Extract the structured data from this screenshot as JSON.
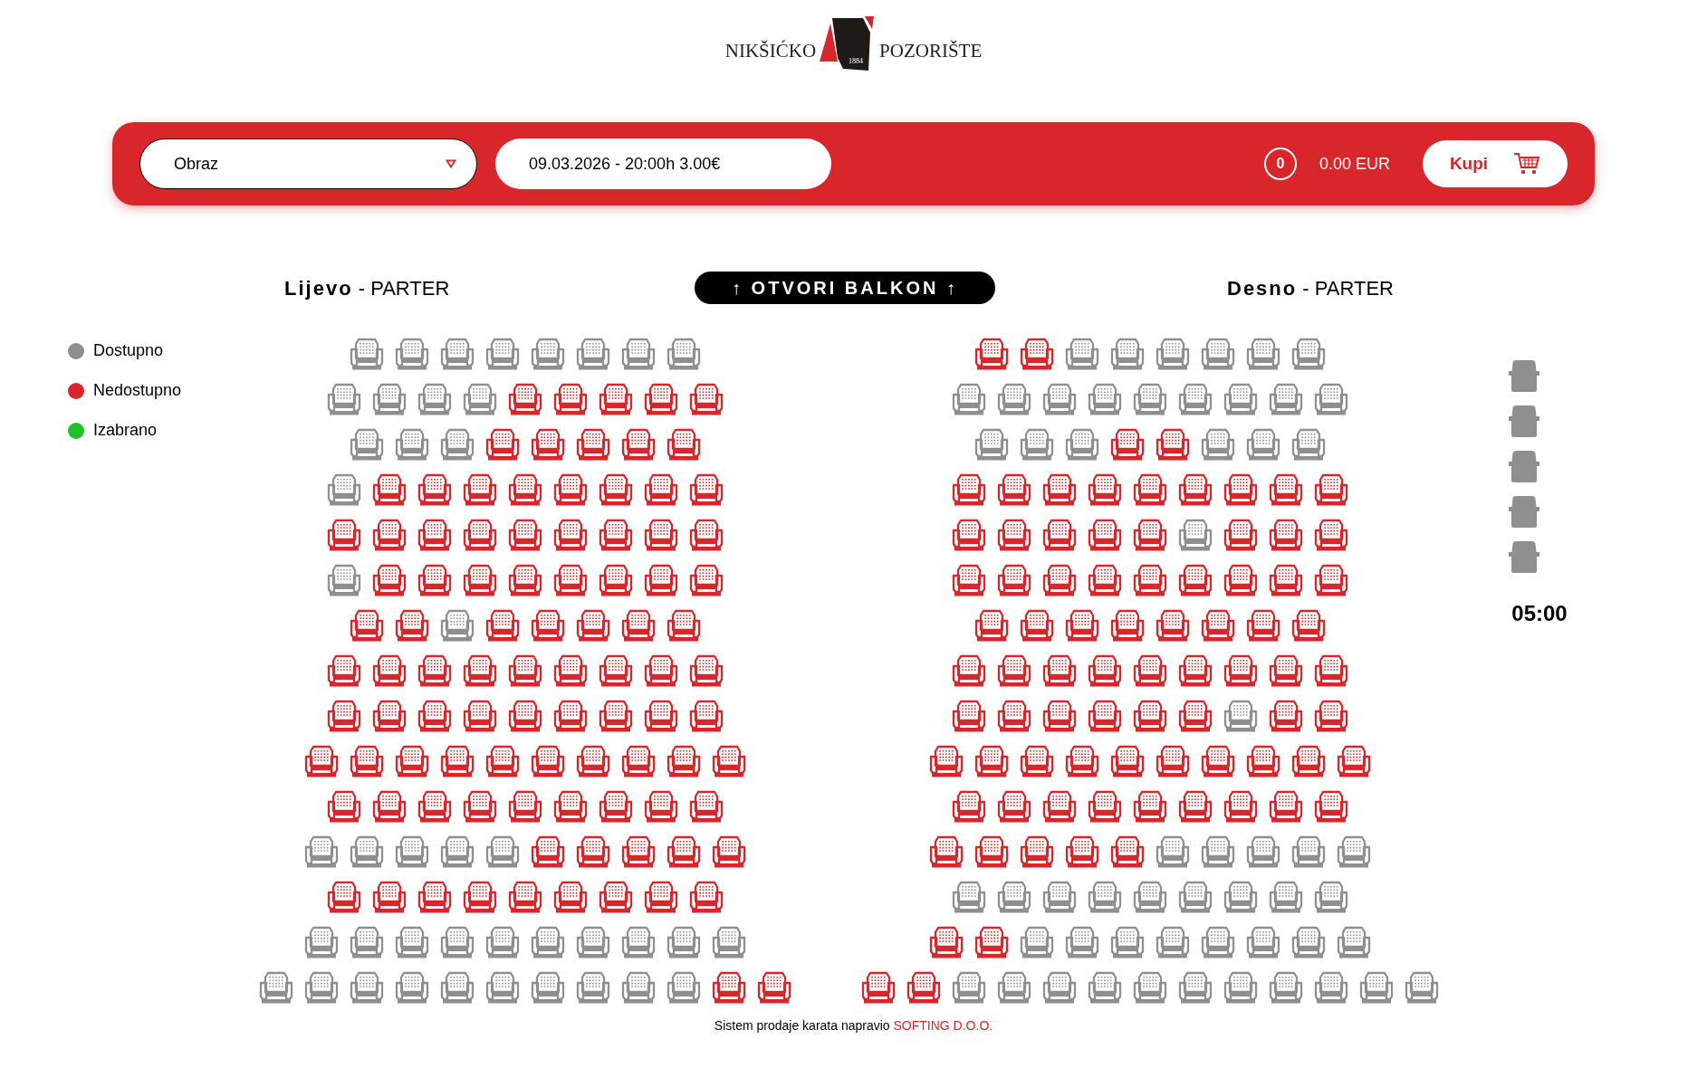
{
  "logo": {
    "left": "NIKŠIĆKO",
    "year": "1884",
    "right": "POZORIŠTE"
  },
  "toolbar": {
    "show_select": {
      "value": "Obraz"
    },
    "date_field": {
      "value": "09.03.2026 - 20:00h 3.00€"
    },
    "ticket_count": "0",
    "total": "0.00 EUR",
    "buy_button": "Kupi"
  },
  "balcony_button": "↑ OTVORI BALKON ↑",
  "legend": [
    {
      "label": "Dostupno",
      "color": "#8f8f8f"
    },
    {
      "label": "Nedostupno",
      "color": "#d9262a"
    },
    {
      "label": "Izabrano",
      "color": "#22c02a"
    }
  ],
  "sections": [
    {
      "heading": "**Lijevo** - PARTER",
      "rows": [
        {
          "seats": [
            {
              "taken": false
            },
            {
              "taken": false
            },
            {
              "taken": false
            },
            {
              "taken": false
            },
            {
              "taken": false
            },
            {
              "taken": false
            },
            {
              "taken": false
            },
            {
              "taken": false
            }
          ]
        },
        {
          "seats": [
            {
              "taken": false
            },
            {
              "taken": false
            },
            {
              "taken": false
            },
            {
              "taken": false
            },
            {
              "taken": true
            },
            {
              "taken": true
            },
            {
              "taken": true
            },
            {
              "taken": true
            },
            {
              "taken": true
            }
          ]
        },
        {
          "seats": [
            {
              "taken": false
            },
            {
              "taken": false
            },
            {
              "taken": false
            },
            {
              "taken": true
            },
            {
              "taken": true
            },
            {
              "taken": true
            },
            {
              "taken": true
            },
            {
              "taken": true
            }
          ]
        },
        {
          "seats": [
            {
              "taken": false
            },
            {
              "taken": true
            },
            {
              "taken": true
            },
            {
              "taken": true
            },
            {
              "taken": true
            },
            {
              "taken": true
            },
            {
              "taken": true
            },
            {
              "taken": true
            },
            {
              "taken": true
            }
          ]
        },
        {
          "seats": [
            {
              "taken": true
            },
            {
              "taken": true
            },
            {
              "taken": true
            },
            {
              "taken": true
            },
            {
              "taken": true
            },
            {
              "taken": true
            },
            {
              "taken": true
            },
            {
              "taken": true
            },
            {
              "taken": true
            }
          ]
        },
        {
          "seats": [
            {
              "taken": false
            },
            {
              "taken": true
            },
            {
              "taken": true
            },
            {
              "taken": true
            },
            {
              "taken": true
            },
            {
              "taken": true
            },
            {
              "taken": true
            },
            {
              "taken": true
            },
            {
              "taken": true
            }
          ]
        },
        {
          "seats": [
            {
              "taken": true
            },
            {
              "taken": true
            },
            {
              "taken": false
            },
            {
              "taken": true
            },
            {
              "taken": true
            },
            {
              "taken": true
            },
            {
              "taken": true
            },
            {
              "taken": true
            }
          ]
        },
        {
          "seats": [
            {
              "taken": true
            },
            {
              "taken": true
            },
            {
              "taken": true
            },
            {
              "taken": true
            },
            {
              "taken": true
            },
            {
              "taken": true
            },
            {
              "taken": true
            },
            {
              "taken": true
            },
            {
              "taken": true
            }
          ]
        },
        {
          "seats": [
            {
              "taken": true
            },
            {
              "taken": true
            },
            {
              "taken": true
            },
            {
              "taken": true
            },
            {
              "taken": true
            },
            {
              "taken": true
            },
            {
              "taken": true
            },
            {
              "taken": true
            },
            {
              "taken": true
            }
          ]
        },
        {
          "seats": [
            {
              "taken": true
            },
            {
              "taken": true
            },
            {
              "taken": true
            },
            {
              "taken": true
            },
            {
              "taken": true
            },
            {
              "taken": true
            },
            {
              "taken": true
            },
            {
              "taken": true
            },
            {
              "taken": true
            },
            {
              "taken": true
            }
          ]
        },
        {
          "seats": [
            {
              "taken": true
            },
            {
              "taken": true
            },
            {
              "taken": true
            },
            {
              "taken": true
            },
            {
              "taken": true
            },
            {
              "taken": true
            },
            {
              "taken": true
            },
            {
              "taken": true
            },
            {
              "taken": true
            }
          ]
        },
        {
          "seats": [
            {
              "taken": false
            },
            {
              "taken": false
            },
            {
              "taken": false
            },
            {
              "taken": false
            },
            {
              "taken": false
            },
            {
              "taken": true
            },
            {
              "taken": true
            },
            {
              "taken": true
            },
            {
              "taken": true
            },
            {
              "taken": true
            }
          ]
        },
        {
          "seats": [
            {
              "taken": true
            },
            {
              "taken": true
            },
            {
              "taken": true
            },
            {
              "taken": true
            },
            {
              "taken": true
            },
            {
              "taken": true
            },
            {
              "taken": true
            },
            {
              "taken": true
            },
            {
              "taken": true
            }
          ]
        },
        {
          "seats": [
            {
              "taken": false
            },
            {
              "taken": false
            },
            {
              "taken": false
            },
            {
              "taken": false
            },
            {
              "taken": false
            },
            {
              "taken": false
            },
            {
              "taken": false
            },
            {
              "taken": false
            },
            {
              "taken": false
            },
            {
              "taken": false
            }
          ]
        },
        {
          "seats": [
            {
              "taken": false
            },
            {
              "taken": false
            },
            {
              "taken": false
            },
            {
              "taken": false
            },
            {
              "taken": false
            },
            {
              "taken": false
            },
            {
              "taken": false
            },
            {
              "taken": false
            },
            {
              "taken": false
            },
            {
              "taken": false
            },
            {
              "taken": true
            },
            {
              "taken": true
            }
          ]
        }
      ]
    },
    {
      "heading": "**Desno** - PARTER",
      "rows": [
        {
          "seats": [
            {
              "taken": true
            },
            {
              "taken": true
            },
            {
              "taken": false
            },
            {
              "taken": false
            },
            {
              "taken": false
            },
            {
              "taken": false
            },
            {
              "taken": false
            },
            {
              "taken": false
            }
          ]
        },
        {
          "seats": [
            {
              "taken": false
            },
            {
              "taken": false
            },
            {
              "taken": false
            },
            {
              "taken": false
            },
            {
              "taken": false
            },
            {
              "taken": false
            },
            {
              "taken": false
            },
            {
              "taken": false
            },
            {
              "taken": false
            }
          ]
        },
        {
          "seats": [
            {
              "taken": false
            },
            {
              "taken": false
            },
            {
              "taken": false
            },
            {
              "taken": true
            },
            {
              "taken": true
            },
            {
              "taken": false
            },
            {
              "taken": false
            },
            {
              "taken": false
            }
          ]
        },
        {
          "seats": [
            {
              "taken": true
            },
            {
              "taken": true
            },
            {
              "taken": true
            },
            {
              "taken": true
            },
            {
              "taken": true
            },
            {
              "taken": true
            },
            {
              "taken": true
            },
            {
              "taken": true
            },
            {
              "taken": true
            }
          ]
        },
        {
          "seats": [
            {
              "taken": true
            },
            {
              "taken": true
            },
            {
              "taken": true
            },
            {
              "taken": true
            },
            {
              "taken": true
            },
            {
              "taken": false
            },
            {
              "taken": true
            },
            {
              "taken": true
            },
            {
              "taken": true
            }
          ]
        },
        {
          "seats": [
            {
              "taken": true
            },
            {
              "taken": true
            },
            {
              "taken": true
            },
            {
              "taken": true
            },
            {
              "taken": true
            },
            {
              "taken": true
            },
            {
              "taken": true
            },
            {
              "taken": true
            },
            {
              "taken": true
            }
          ]
        },
        {
          "seats": [
            {
              "taken": true
            },
            {
              "taken": true
            },
            {
              "taken": true
            },
            {
              "taken": true
            },
            {
              "taken": true
            },
            {
              "taken": true
            },
            {
              "taken": true
            },
            {
              "taken": true
            }
          ]
        },
        {
          "seats": [
            {
              "taken": true
            },
            {
              "taken": true
            },
            {
              "taken": true
            },
            {
              "taken": true
            },
            {
              "taken": true
            },
            {
              "taken": true
            },
            {
              "taken": true
            },
            {
              "taken": true
            },
            {
              "taken": true
            }
          ]
        },
        {
          "seats": [
            {
              "taken": true
            },
            {
              "taken": true
            },
            {
              "taken": true
            },
            {
              "taken": true
            },
            {
              "taken": true
            },
            {
              "taken": true
            },
            {
              "taken": false
            },
            {
              "taken": true
            },
            {
              "taken": true
            }
          ]
        },
        {
          "seats": [
            {
              "taken": true
            },
            {
              "taken": true
            },
            {
              "taken": true
            },
            {
              "taken": true
            },
            {
              "taken": true
            },
            {
              "taken": true
            },
            {
              "taken": true
            },
            {
              "taken": true
            },
            {
              "taken": true
            },
            {
              "taken": true
            }
          ]
        },
        {
          "seats": [
            {
              "taken": true
            },
            {
              "taken": true
            },
            {
              "taken": true
            },
            {
              "taken": true
            },
            {
              "taken": true
            },
            {
              "taken": true
            },
            {
              "taken": true
            },
            {
              "taken": true
            },
            {
              "taken": true
            }
          ]
        },
        {
          "seats": [
            {
              "taken": true
            },
            {
              "taken": true
            },
            {
              "taken": true
            },
            {
              "taken": true
            },
            {
              "taken": true
            },
            {
              "taken": false
            },
            {
              "taken": false
            },
            {
              "taken": false
            },
            {
              "taken": false
            },
            {
              "taken": false
            }
          ]
        },
        {
          "seats": [
            {
              "taken": false
            },
            {
              "taken": false
            },
            {
              "taken": false
            },
            {
              "taken": false
            },
            {
              "taken": false
            },
            {
              "taken": false
            },
            {
              "taken": false
            },
            {
              "taken": false
            },
            {
              "taken": false
            }
          ]
        },
        {
          "seats": [
            {
              "taken": true
            },
            {
              "taken": true
            },
            {
              "taken": false
            },
            {
              "taken": false
            },
            {
              "taken": false
            },
            {
              "taken": false
            },
            {
              "taken": false
            },
            {
              "taken": false
            },
            {
              "taken": false
            },
            {
              "taken": false
            }
          ]
        },
        {
          "seats": [
            {
              "taken": true
            },
            {
              "taken": true
            },
            {
              "taken": false
            },
            {
              "taken": false
            },
            {
              "taken": false
            },
            {
              "taken": false
            },
            {
              "taken": false
            },
            {
              "taken": false
            },
            {
              "taken": false
            },
            {
              "taken": false
            },
            {
              "taken": false
            },
            {
              "taken": false
            },
            {
              "taken": false
            }
          ]
        }
      ]
    }
  ],
  "timer": "05:00",
  "footer": {
    "text": "Sistem prodaje karata napravio",
    "link": "SOFTING D.O.O."
  }
}
